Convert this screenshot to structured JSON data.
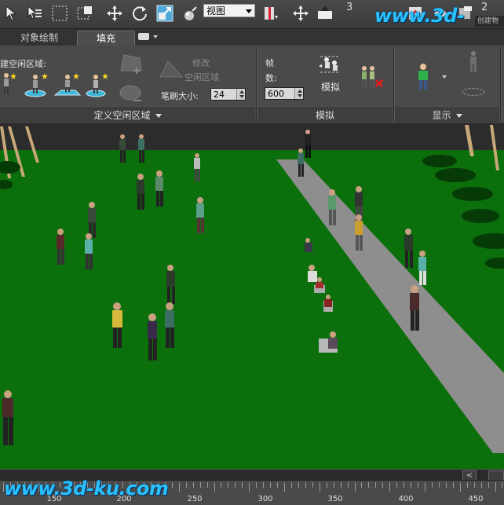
{
  "toolbar": {
    "view_dropdown": "视图",
    "counter_left": "3",
    "counter_right": "2",
    "create_tab_label": "创建物",
    "watermark": "www.3d-ku.com"
  },
  "tabs": [
    {
      "label": "对象绘制",
      "active": false
    },
    {
      "label": "填充",
      "active": true
    }
  ],
  "ribbon": {
    "define_panel": {
      "create_idle_area_label": "建空闲区域:",
      "modify_label": "修改",
      "idle_area_label": "空闲区域",
      "brush_size_label": "笔刷大小:",
      "brush_size_value": "24",
      "footer": "定义空闲区域"
    },
    "simulate_panel": {
      "frames_label": "帧",
      "frames_label2": "数:",
      "frames_value": "600",
      "simulate_button": "模拟",
      "footer": "模拟"
    },
    "display_panel": {
      "footer": "显示"
    }
  },
  "timeline": {
    "labels": [
      "150",
      "200",
      "250",
      "300",
      "350",
      "400",
      "450"
    ]
  },
  "scrollbar": {
    "left_arrow": "<"
  },
  "colors": {
    "grass": "#0b6f0b",
    "path": "#8e8e8e",
    "accent_icon": "#3fb5d8",
    "watermark": "#29c1ff"
  }
}
